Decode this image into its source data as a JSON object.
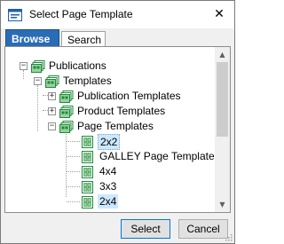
{
  "window": {
    "title": "Select Page Template",
    "close_glyph": "✕"
  },
  "tabs": [
    {
      "label": "Browse",
      "active": true
    },
    {
      "label": "Search",
      "active": false
    }
  ],
  "tree": {
    "publications": {
      "label": "Publications",
      "expander": "−"
    },
    "templates": {
      "label": "Templates",
      "expander": "−"
    },
    "publication_templates": {
      "label": "Publication Templates",
      "expander": "+"
    },
    "product_templates": {
      "label": "Product Templates",
      "expander": "+"
    },
    "page_templates": {
      "label": "Page Templates",
      "expander": "−"
    },
    "items": [
      {
        "label": "2x2",
        "state": "focused"
      },
      {
        "label": "GALLEY Page Template",
        "state": "normal"
      },
      {
        "label": "4x4",
        "state": "normal"
      },
      {
        "label": "3x3",
        "state": "normal"
      },
      {
        "label": "2x4",
        "state": "selected"
      }
    ]
  },
  "scrollbar": {
    "up_glyph": "▲",
    "down_glyph": "▼"
  },
  "buttons": {
    "select_label": "Select",
    "cancel_label": "Cancel"
  },
  "colors": {
    "tab_active": "#2a6cb6",
    "selection": "#cce8ff",
    "icon_green": "#1e8a3a"
  }
}
